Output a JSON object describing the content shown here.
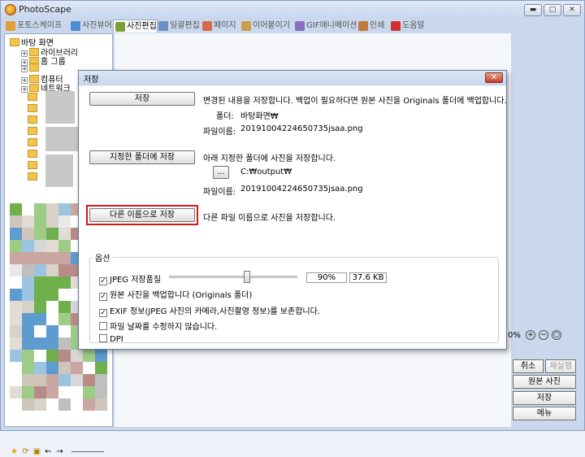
{
  "app": {
    "title": "PhotoScape"
  },
  "window_buttons": {
    "minimize": "▬",
    "maximize": "□",
    "close": "✕"
  },
  "tabs": [
    {
      "label": "포토스케이프",
      "color": "#e3a03a",
      "active": false
    },
    {
      "label": "사진뷰어",
      "color": "#4f8fd0",
      "active": false
    },
    {
      "label": "사진편집",
      "color": "#7a9f38",
      "active": true
    },
    {
      "label": "일괄편집",
      "color": "#6b8fc0",
      "active": false
    },
    {
      "label": "페이지",
      "color": "#d76a4a",
      "active": false
    },
    {
      "label": "이어붙이기",
      "color": "#c9a04a",
      "active": false
    },
    {
      "label": "GIF애니메이션",
      "color": "#8a6fc0",
      "active": false
    },
    {
      "label": "인쇄",
      "color": "#c07a3a",
      "active": false
    },
    {
      "label": "도움말",
      "color": "#d03030",
      "active": false
    }
  ],
  "tree": [
    {
      "label": "바탕 화면",
      "icon": "desktop-icon"
    },
    {
      "label": "라이브러리",
      "icon": "library-icon"
    },
    {
      "label": "홈 그룹",
      "icon": "homegroup-icon"
    },
    {
      "label": "",
      "icon": "user-icon"
    },
    {
      "label": "컴퓨터",
      "icon": "computer-icon"
    },
    {
      "label": "네트워크",
      "icon": "network-icon"
    }
  ],
  "dialog": {
    "title": "저장",
    "close": "✕",
    "save_button": "저장",
    "save_desc": "변경된 내용을 저장합니다. 백업이 필요하다면 원본 사진을 Originals 폴더에 백업합니다.",
    "folder_label": "폴더:",
    "folder_value": "바탕화면₩",
    "filename_label": "파일이름:",
    "filename_value": "20191004224650735jsaa.png",
    "save_folder_button": "지정한 폴더에 저장",
    "save_folder_desc": "아래 지정한 폴더에 사진을 저장합니다.",
    "browse_button": "...",
    "output_path": "C:₩output₩",
    "filename_value_2": "20191004224650735jsaa.png",
    "save_as_button": "다른 이름으로 저장",
    "save_as_desc": "다른 파일 이름으로 사진을 저장합니다.",
    "options": {
      "title": "옵션",
      "jpeg_quality_label": "JPEG 저장품질",
      "jpeg_quality_checked": true,
      "jpeg_quality_value": "90%",
      "jpeg_quality_fraction": 0.9,
      "file_size": "37.6 KB",
      "backup_label": "원본 사진을 백업합니다 (Originals 폴더)",
      "backup_checked": true,
      "exif_label": "EXIF 정보(JPEG 사진의 카메라,사진촬영 정보)를 보존합니다.",
      "exif_checked": true,
      "no_date_label": "파일 날짜를 수정하지 않습니다.",
      "no_date_checked": false,
      "dpi_label": "DPI",
      "dpi_checked": false
    }
  },
  "zoom": {
    "value": "0%"
  },
  "side_buttons": {
    "cancel": "취소",
    "redo": "재실행",
    "original": "원본 사진",
    "save": "저장",
    "menu": "메뉴"
  },
  "colors": {
    "highlight": "#d21919",
    "titlebar": "#c7d7ee"
  }
}
